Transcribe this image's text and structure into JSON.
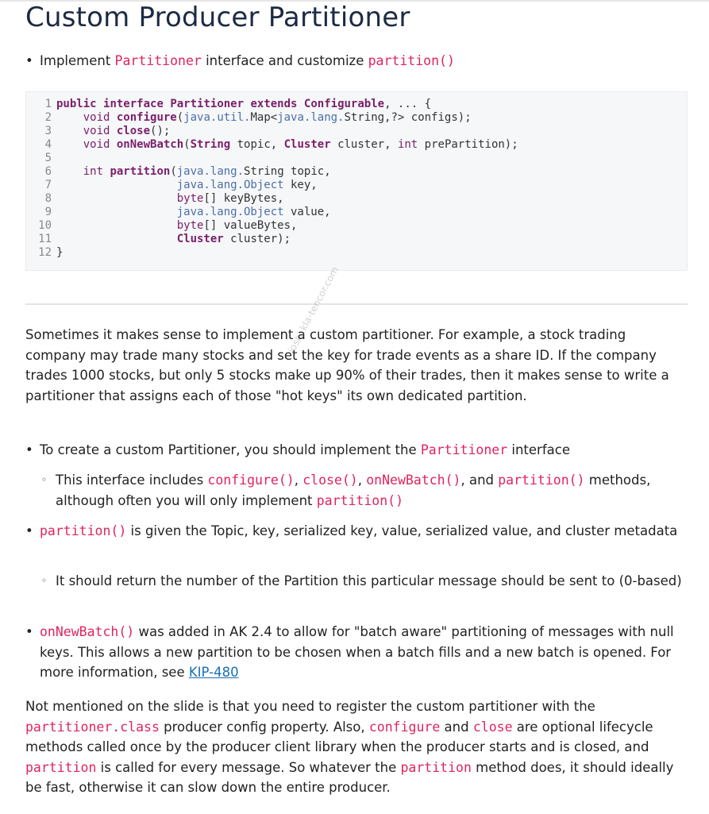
{
  "title": "Custom Producer Partitioner",
  "intro_bullet": {
    "pre": "Implement ",
    "code1": "Partitioner",
    "mid": " interface and customize ",
    "code2": "partition()"
  },
  "code_lines": [
    {
      "n": "1",
      "html": "<span class='kw'>public</span> <span class='kw'>interface</span> <span class='ty'>Partitioner</span> <span class='kw'>extends</span> <span class='ty'>Configurable</span>, ... {"
    },
    {
      "n": "2",
      "html": "    <span class='tp'>void</span> <span class='fn'>configure</span>(<span class='pkg'>java.util.</span>Map&lt;<span class='pkg'>java.lang.</span>String,?&gt; configs);"
    },
    {
      "n": "3",
      "html": "    <span class='tp'>void</span> <span class='fn'>close</span>();"
    },
    {
      "n": "4",
      "html": "    <span class='tp'>void</span> <span class='fn'>onNewBatch</span>(<span class='ty'>String</span> topic, <span class='ty'>Cluster</span> cluster, <span class='tp'>int</span> prePartition);"
    },
    {
      "n": "5",
      "html": ""
    },
    {
      "n": "6",
      "html": "    <span class='tp'>int</span> <span class='fn'>partition</span>(<span class='pkg'>java.lang.</span>String topic,"
    },
    {
      "n": "7",
      "html": "                  <span class='pkg'>java.lang.Object</span> key,"
    },
    {
      "n": "8",
      "html": "                  <span class='tp'>byte</span>[] keyBytes,"
    },
    {
      "n": "9",
      "html": "                  <span class='pkg'>java.lang.Object</span> value,"
    },
    {
      "n": "10",
      "html": "                  <span class='tp'>byte</span>[] valueBytes,"
    },
    {
      "n": "11",
      "html": "                  <span class='ty'>Cluster</span> cluster);"
    },
    {
      "n": "12",
      "html": "}"
    }
  ],
  "paragraph1": "Sometimes it makes sense to implement a custom partitioner. For example, a stock trading company may trade many stocks and set the key for trade events as a share ID. If the company trades 1000 stocks, but only 5 stocks make up 90% of their trades, then it makes sense to write a partitioner that assigns each of those \"hot keys\" its own dedicated partition.",
  "bullets": {
    "b1_pre": "To create a custom Partitioner, you should implement the ",
    "b1_code": "Partitioner",
    "b1_post": " interface",
    "b1a_pre": "This interface includes ",
    "b1a_c1": "configure()",
    "b1a_s1": ", ",
    "b1a_c2": "close()",
    "b1a_s2": ", ",
    "b1a_c3": "onNewBatch()",
    "b1a_s3": ", and ",
    "b1a_c4": "partition()",
    "b1a_mid": " methods, although often you will only implement ",
    "b1a_c5": "partition()",
    "b2_code": "partition()",
    "b2_text": " is given the Topic, key, serialized key, value, serialized value, and cluster metadata",
    "b2a_text": "It should return the number of the Partition this particular message should be sent to (0-based)",
    "b3_code": "onNewBatch()",
    "b3_text": " was added in AK 2.4 to allow for \"batch aware\" partitioning of messages with null keys. This allows a new partition to be chosen when a batch fills and a new batch is opened. For more information, see ",
    "b3_link": "KIP-480"
  },
  "paragraph2": {
    "t1": "Not mentioned on the slide is that you need to register the custom partitioner with the ",
    "c1": "partitioner.class",
    "t2": " producer config property. Also, ",
    "c2": "configure",
    "t3": " and ",
    "c3": "close",
    "t4": " are optional lifecycle methods called once by the producer client library when the producer starts and is closed, and ",
    "c4": "partition",
    "t5": " is called for every message. So whatever the ",
    "c5": "partition",
    "t6": " method does, it should ideally be fast, otherwise it can slow down the entire producer."
  },
  "watermark": "joshi.kla-tencor.com",
  "colors": {
    "title": "#1c2a44",
    "inline_code": "#e0245e",
    "link": "#1a6fb5",
    "code_bg": "#f6f7f9"
  }
}
